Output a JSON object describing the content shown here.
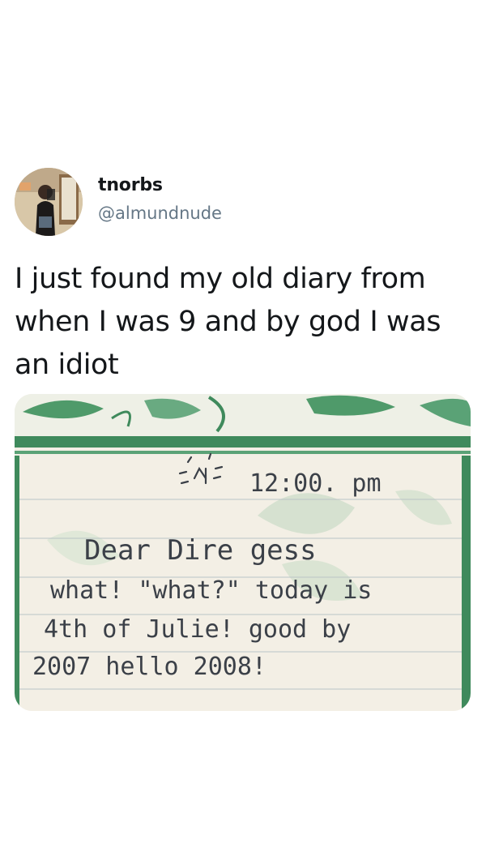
{
  "tweet": {
    "display_name": "tnorbs",
    "handle": "@almundnude",
    "text": "I just found my old diary from when I was 9 and by god I was an idiot",
    "avatar_icon": "user-avatar-photo",
    "attached_photo": {
      "description_icon": "diary-page-photo",
      "handwriting": {
        "time": "12:00. pm",
        "line1": "Dear Dire gess",
        "line2": "what! \"what?\" today is",
        "line3": "4th of Julie! good by",
        "line4": "2007 hello 2008!"
      }
    }
  },
  "colors": {
    "name_color": "#14171a",
    "handle_color": "#657786",
    "paper_green": "#3f8a5c",
    "paper_light": "#f3efe6"
  }
}
